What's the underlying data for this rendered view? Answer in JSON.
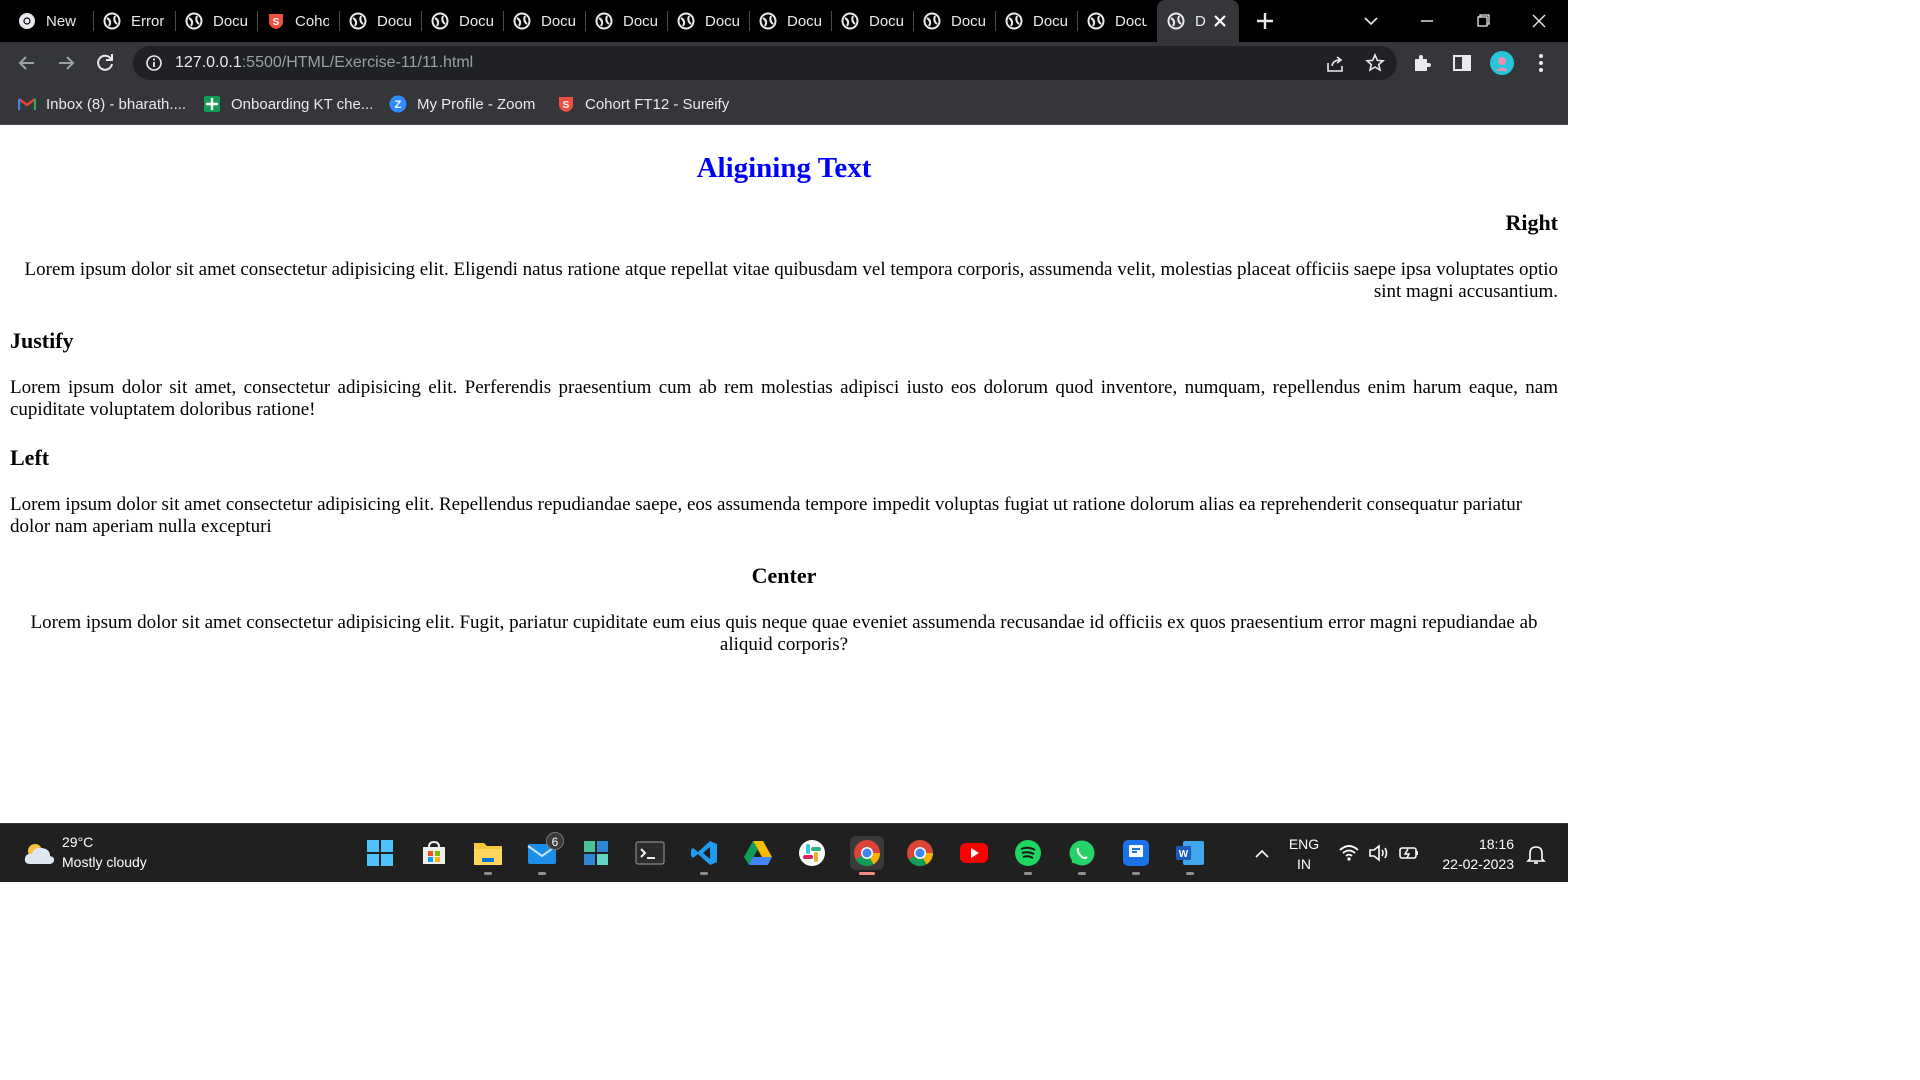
{
  "browser": {
    "tabs": [
      {
        "label": "New",
        "favicon": "chrome-icon"
      },
      {
        "label": "Error",
        "favicon": "globe-icon"
      },
      {
        "label": "Docu",
        "favicon": "globe-icon"
      },
      {
        "label": "Coho",
        "favicon": "sureify-icon"
      },
      {
        "label": "Docu",
        "favicon": "globe-icon"
      },
      {
        "label": "Docu",
        "favicon": "globe-icon"
      },
      {
        "label": "Docu",
        "favicon": "globe-icon"
      },
      {
        "label": "Docu",
        "favicon": "globe-icon"
      },
      {
        "label": "Docu",
        "favicon": "globe-icon"
      },
      {
        "label": "Docu",
        "favicon": "globe-icon"
      },
      {
        "label": "Docu",
        "favicon": "globe-icon"
      },
      {
        "label": "Docu",
        "favicon": "globe-icon"
      },
      {
        "label": "Docu",
        "favicon": "globe-icon"
      },
      {
        "label": "Docu",
        "favicon": "globe-icon"
      },
      {
        "label": "D",
        "favicon": "globe-icon",
        "active": true
      }
    ],
    "url": {
      "host": "127.0.0.1",
      "path": ":5500/HTML/Exercise-11/11.html"
    },
    "bookmarks": [
      {
        "label": "Inbox (8) - bharath....",
        "icon": "gmail-icon"
      },
      {
        "label": "Onboarding KT che...",
        "icon": "sheets-icon"
      },
      {
        "label": "My Profile - Zoom",
        "icon": "zoom-icon"
      },
      {
        "label": "Cohort FT12 - Sureify",
        "icon": "sureify-icon"
      }
    ],
    "colors": {
      "tabstrip": "#000000",
      "toolbar": "#35363a",
      "omnibox": "#202124",
      "profile": "#26c6da"
    }
  },
  "page": {
    "title": "Aligining Text",
    "title_color": "#0000ff",
    "sections": [
      {
        "heading": "Right",
        "align": "right",
        "text": "Lorem ipsum dolor sit amet consectetur adipisicing elit. Eligendi natus ratione atque repellat vitae quibusdam vel tempora corporis, assumenda velit, molestias placeat officiis saepe ipsa voluptates optio sint magni accusantium."
      },
      {
        "heading": "Justify",
        "align": "justify",
        "text": "Lorem ipsum dolor sit amet, consectetur adipisicing elit. Perferendis praesentium cum ab rem molestias adipisci iusto eos dolorum quod inventore, numquam, repellendus enim harum eaque, nam cupiditate voluptatem doloribus ratione!"
      },
      {
        "heading": "Left",
        "align": "left",
        "text": "Lorem ipsum dolor sit amet consectetur adipisicing elit. Repellendus repudiandae saepe, eos assumenda tempore impedit voluptas fugiat ut ratione dolorum alias ea reprehenderit consequatur pariatur dolor nam aperiam nulla excepturi"
      },
      {
        "heading": "Center",
        "align": "center",
        "text": "Lorem ipsum dolor sit amet consectetur adipisicing elit. Fugit, pariatur cupiditate eum eius quis neque quae eveniet assumenda recusandae id officiis ex quos praesentium error magni repudiandae ab aliquid corporis?"
      }
    ]
  },
  "taskbar": {
    "weather": {
      "temp": "29°C",
      "desc": "Mostly cloudy"
    },
    "mail_badge": "6",
    "lang": {
      "line1": "ENG",
      "line2": "IN"
    },
    "clock": {
      "time": "18:16",
      "date": "22-02-2023"
    },
    "apps": [
      "start-icon",
      "store-icon",
      "file-explorer-icon",
      "mail-icon",
      "widgets-icon",
      "terminal-icon",
      "vscode-icon",
      "google-drive-icon",
      "slack-icon",
      "chrome-icon",
      "chrome-profile-icon",
      "youtube-icon",
      "spotify-icon",
      "whatsapp-icon",
      "app-icon",
      "word-icon"
    ]
  }
}
